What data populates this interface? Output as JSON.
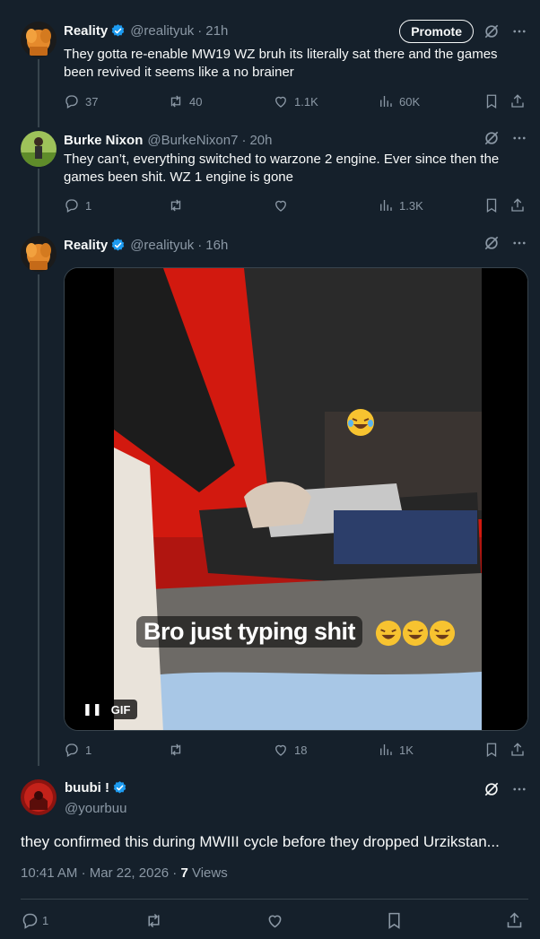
{
  "tweets": [
    {
      "name": "Reality",
      "handle": "@realityuk",
      "time": "21h",
      "promote_label": "Promote",
      "text": "They gotta re-enable MW19 WZ bruh its literally sat there and the games been revived it seems like a no brainer",
      "replies": "37",
      "retweets": "40",
      "likes": "1.1K",
      "views": "60K"
    },
    {
      "name": "Burke Nixon",
      "handle": "@BurkeNixon7",
      "time": "20h",
      "text": "They can’t, everything switched to warzone 2 engine. Ever since then the games been shit. WZ 1 engine is gone",
      "replies": "1",
      "retweets": "",
      "likes": "",
      "views": "1.3K"
    },
    {
      "name": "Reality",
      "handle": "@realityuk",
      "time": "16h",
      "media": {
        "caption": "Bro just typing shit",
        "badge": "GIF"
      },
      "replies": "1",
      "retweets": "",
      "likes": "18",
      "views": "1K"
    }
  ],
  "main_tweet": {
    "name": "buubi !",
    "handle": "@yourbuu",
    "text": "they confirmed this during MWIII cycle before they dropped Urzikstan...",
    "time": "10:41 AM",
    "date": "Mar 22, 2026",
    "views_count": "7",
    "views_label": "Views",
    "replies": "1"
  },
  "icons": [
    "verified-badge-icon",
    "grok-icon",
    "more-icon",
    "reply-icon",
    "retweet-icon",
    "like-icon",
    "views-icon",
    "bookmark-icon",
    "share-icon",
    "pause-icon"
  ],
  "colors": {
    "background": "#15202b",
    "text": "#f7f9f9",
    "secondary": "#8b98a5",
    "verified": "#1d9bf0",
    "border": "#38444d"
  }
}
